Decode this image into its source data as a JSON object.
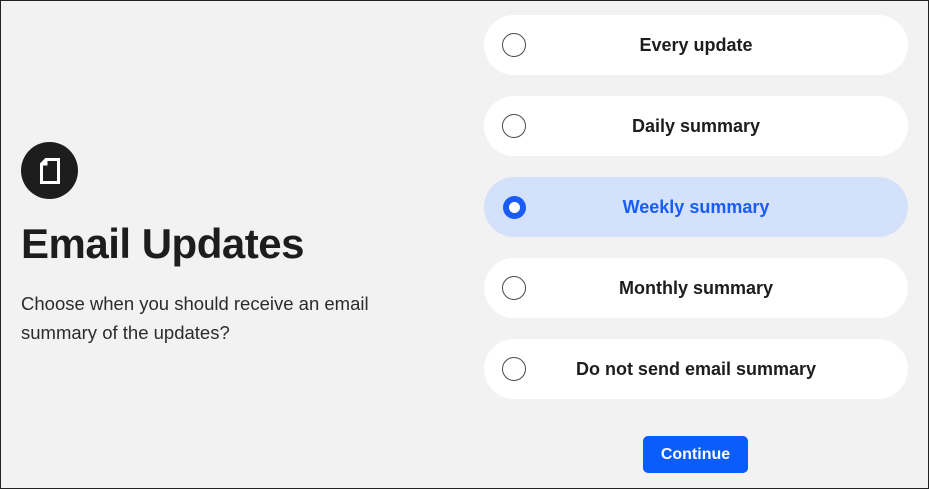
{
  "header": {
    "icon": "document-icon",
    "title": "Email Updates",
    "description": "Choose when you should receive an email summary of the updates?"
  },
  "options": [
    {
      "label": "Every update",
      "selected": false
    },
    {
      "label": "Daily summary",
      "selected": false
    },
    {
      "label": "Weekly summary",
      "selected": true
    },
    {
      "label": "Monthly summary",
      "selected": false
    },
    {
      "label": "Do not send email summary",
      "selected": false
    }
  ],
  "continue_label": "Continue",
  "colors": {
    "accent": "#0a5cfb",
    "selected_background": "#d4e1fb",
    "page_background": "#f2f2f2",
    "icon_background": "#1d1d1d"
  }
}
